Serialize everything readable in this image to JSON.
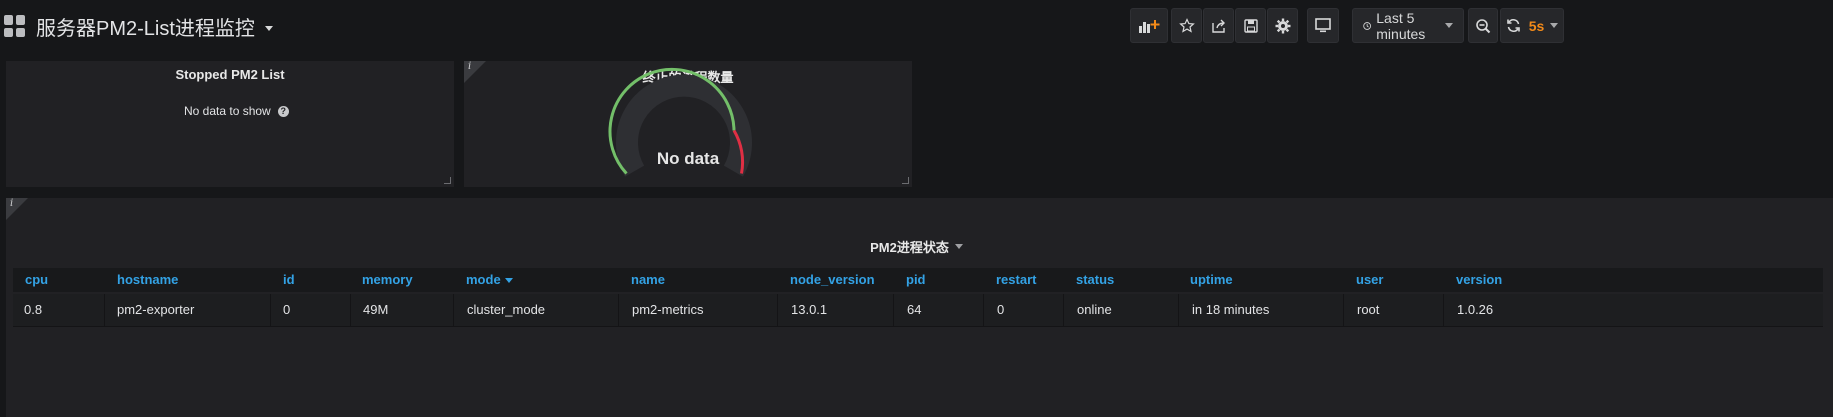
{
  "dashboard": {
    "title": "服务器PM2-List进程监控"
  },
  "toolbar": {
    "time_range_label": "Last 5 minutes",
    "refresh_interval": "5s"
  },
  "panels": {
    "stopped_list": {
      "title": "Stopped PM2 List",
      "no_data": "No data to show",
      "help_glyph": "?"
    },
    "stopped_count": {
      "title": "终止的进程数量",
      "info_glyph": "i",
      "gauge_text": "No data"
    },
    "status_table": {
      "title": "PM2进程状态",
      "info_glyph": "i",
      "columns": [
        "cpu",
        "hostname",
        "id",
        "memory",
        "mode",
        "name",
        "node_version",
        "pid",
        "restart",
        "status",
        "uptime",
        "user",
        "version"
      ],
      "rows": [
        [
          "0.8",
          "pm2-exporter",
          "0",
          "49M",
          "cluster_mode",
          "pm2-metrics",
          "13.0.1",
          "64",
          "0",
          "online",
          "in 18 minutes",
          "root",
          "1.0.26"
        ]
      ],
      "sorted_column": "mode"
    }
  },
  "colors": {
    "accent_blue": "#33a2e5",
    "refresh_orange": "#f28a19",
    "gauge_green": "#73bf69",
    "gauge_red": "#e02f44"
  }
}
